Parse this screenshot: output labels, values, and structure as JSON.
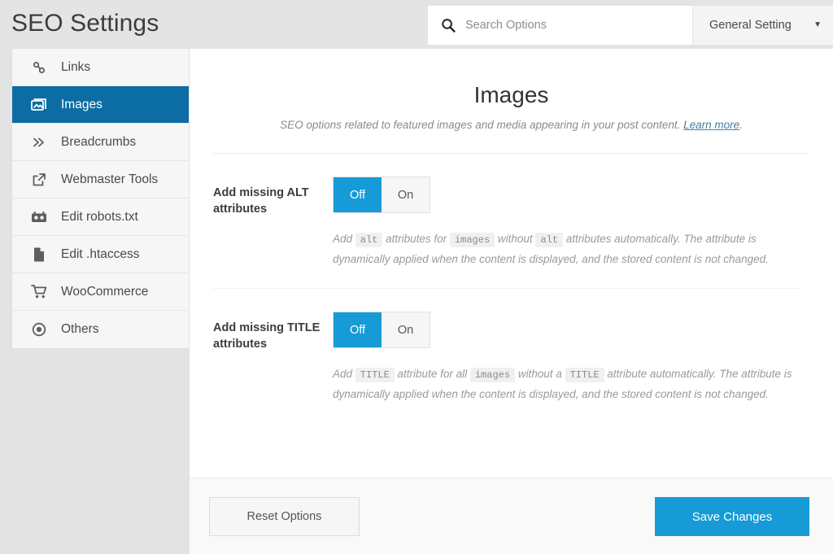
{
  "header": {
    "title": "SEO Settings",
    "search": {
      "placeholder": "Search Options",
      "value": "",
      "icon": "search-icon"
    },
    "dropdown": {
      "selected": "General Setting",
      "caret": "▼"
    }
  },
  "sidebar": {
    "items": [
      {
        "label": "Links",
        "icon": "chain-link-icon",
        "active": false
      },
      {
        "label": "Images",
        "icon": "image-icon",
        "active": true
      },
      {
        "label": "Breadcrumbs",
        "icon": "chevron-double-right-icon",
        "active": false
      },
      {
        "label": "Webmaster Tools",
        "icon": "external-link-icon",
        "active": false
      },
      {
        "label": "Edit robots.txt",
        "icon": "robot-icon",
        "active": false
      },
      {
        "label": "Edit .htaccess",
        "icon": "file-icon",
        "active": false
      },
      {
        "label": "WooCommerce",
        "icon": "shopping-cart-icon",
        "active": false
      },
      {
        "label": "Others",
        "icon": "target-dot-icon",
        "active": false
      }
    ]
  },
  "main": {
    "title": "Images",
    "subtitle_text": "SEO options related to featured images and media appearing in your post content. ",
    "subtitle_link": "Learn more",
    "subtitle_tail": ".",
    "settings": [
      {
        "label": "Add missing ALT attributes",
        "toggle": {
          "off_label": "Off",
          "on_label": "On",
          "selected": "Off"
        },
        "desc_parts": [
          {
            "t": "text",
            "v": "Add "
          },
          {
            "t": "code",
            "v": "alt"
          },
          {
            "t": "text",
            "v": " attributes for "
          },
          {
            "t": "code",
            "v": "images"
          },
          {
            "t": "text",
            "v": " without "
          },
          {
            "t": "code",
            "v": "alt"
          },
          {
            "t": "text",
            "v": " attributes automatically. The attribute is dynamically applied when the content is displayed, and the stored content is not changed."
          }
        ]
      },
      {
        "label": "Add missing TITLE attributes",
        "toggle": {
          "off_label": "Off",
          "on_label": "On",
          "selected": "Off"
        },
        "desc_parts": [
          {
            "t": "text",
            "v": "Add "
          },
          {
            "t": "code",
            "v": "TITLE"
          },
          {
            "t": "text",
            "v": " attribute for all "
          },
          {
            "t": "code",
            "v": "images"
          },
          {
            "t": "text",
            "v": " without a "
          },
          {
            "t": "code",
            "v": "TITLE"
          },
          {
            "t": "text",
            "v": " attribute automatically. The attribute is dynamically applied when the content is displayed, and the stored content is not changed."
          }
        ]
      }
    ]
  },
  "footer": {
    "reset_label": "Reset Options",
    "save_label": "Save Changes"
  },
  "colors": {
    "accent_blue": "#169bd7",
    "sidebar_active": "#0b6da4",
    "page_bg": "#e3e3e3",
    "panel_bg": "#ffffff",
    "link": "#4a7f9e"
  }
}
